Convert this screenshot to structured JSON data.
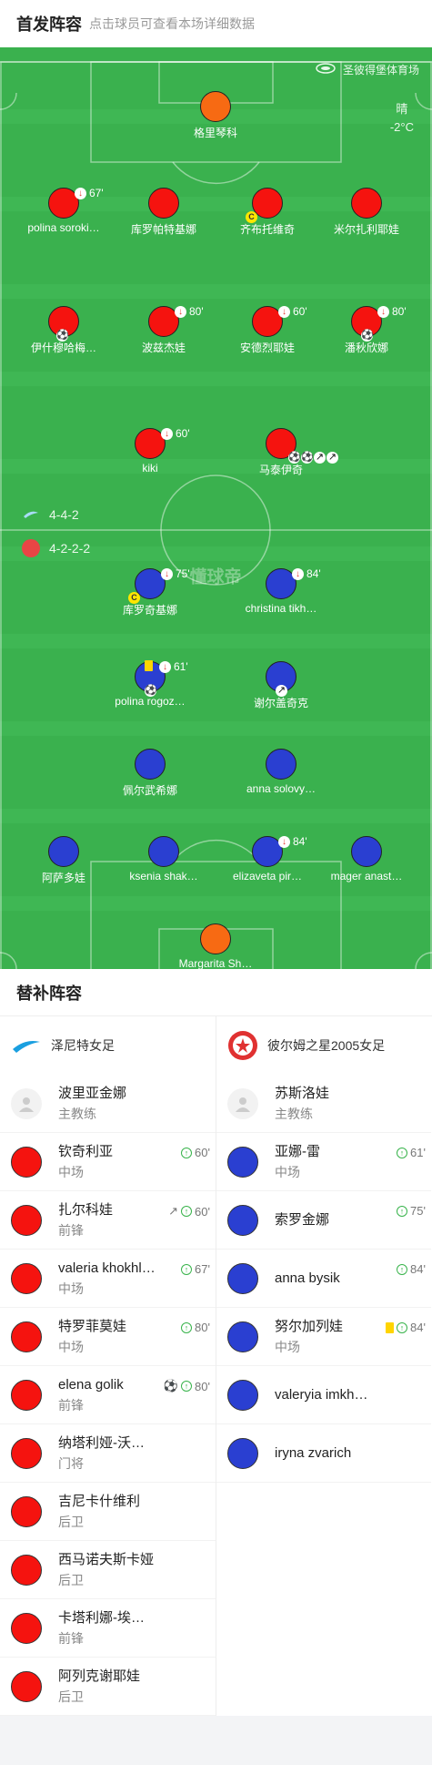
{
  "header": {
    "title": "首发阵容",
    "subtitle": "点击球员可查看本场详细数据"
  },
  "pitch": {
    "venue": "圣彼得堡体育场",
    "weather": "晴",
    "temperature": "-2°C",
    "watermark": "懂球帝",
    "home_formation": "4-4-2",
    "away_formation": "4-2-2-2"
  },
  "home_players": [
    {
      "name": "格里琴科",
      "sub": ""
    },
    {
      "name": "polina soroki…",
      "sub": "67'"
    },
    {
      "name": "库罗帕特基娜",
      "sub": ""
    },
    {
      "name": "齐布托维奇",
      "sub": ""
    },
    {
      "name": "米尔扎利耶娃",
      "sub": ""
    },
    {
      "name": "伊什穆哈梅…",
      "sub": ""
    },
    {
      "name": "波兹杰娃",
      "sub": "80'"
    },
    {
      "name": "安德烈耶娃",
      "sub": "60'"
    },
    {
      "name": "潘秋欣娜",
      "sub": "80'"
    },
    {
      "name": "kiki",
      "sub": "60'"
    },
    {
      "name": "马泰伊奇",
      "sub": ""
    }
  ],
  "away_players": [
    {
      "name": "库罗奇基娜",
      "sub": "75'"
    },
    {
      "name": "christina tikh…",
      "sub": "84'"
    },
    {
      "name": "polina rogoz…",
      "sub": "61'"
    },
    {
      "name": "谢尔盖奇克",
      "sub": ""
    },
    {
      "name": "佩尔武希娜",
      "sub": ""
    },
    {
      "name": "anna solovy…",
      "sub": ""
    },
    {
      "name": "阿萨多娃",
      "sub": ""
    },
    {
      "name": "ksenia shak…",
      "sub": ""
    },
    {
      "name": "elizaveta pir…",
      "sub": "84'"
    },
    {
      "name": "mager anast…",
      "sub": ""
    },
    {
      "name": "Margarita Sh…",
      "sub": ""
    }
  ],
  "subs": {
    "title": "替补阵容",
    "home": {
      "team": "泽尼特女足",
      "coach": {
        "name": "波里亚金娜",
        "role": "主教练"
      },
      "players": [
        {
          "name": "钦奇利亚",
          "pos": "中场",
          "time": "60'"
        },
        {
          "name": "扎尔科娃",
          "pos": "前锋",
          "time": "60'"
        },
        {
          "name": "valeria khokhl…",
          "pos": "中场",
          "time": "67'"
        },
        {
          "name": "特罗菲莫娃",
          "pos": "中场",
          "time": "80'"
        },
        {
          "name": "elena golik",
          "pos": "前锋",
          "time": "80'"
        },
        {
          "name": "纳塔利娅-沃…",
          "pos": "门将",
          "time": ""
        },
        {
          "name": "吉尼卡什维利",
          "pos": "后卫",
          "time": ""
        },
        {
          "name": "西马诺夫斯卡娅",
          "pos": "后卫",
          "time": ""
        },
        {
          "name": "卡塔利娜-埃…",
          "pos": "前锋",
          "time": ""
        },
        {
          "name": "阿列克谢耶娃",
          "pos": "后卫",
          "time": ""
        }
      ]
    },
    "away": {
      "team": "彼尔姆之星2005女足",
      "coach": {
        "name": "苏斯洛娃",
        "role": "主教练"
      },
      "players": [
        {
          "name": "亚娜-雷",
          "pos": "中场",
          "time": "61'"
        },
        {
          "name": "索罗金娜",
          "pos": "",
          "time": "75'"
        },
        {
          "name": "anna bysik",
          "pos": "",
          "time": "84'"
        },
        {
          "name": "努尔加列娃",
          "pos": "中场",
          "time": "84'"
        },
        {
          "name": "valeryia imkh…",
          "pos": "",
          "time": ""
        },
        {
          "name": "iryna zvarich",
          "pos": "",
          "time": ""
        }
      ]
    }
  },
  "colors": {
    "pitch": "#3ab14e",
    "home": "#f5130f",
    "away": "#2a3fd1",
    "keeper": "#f76a13"
  }
}
